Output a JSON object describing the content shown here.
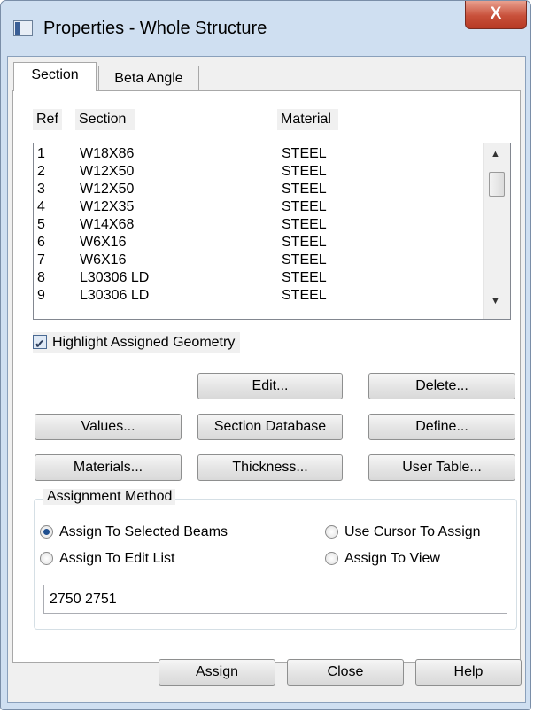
{
  "window": {
    "title": "Properties - Whole Structure",
    "close_label": "X"
  },
  "tabs": [
    {
      "label": "Section",
      "active": true
    },
    {
      "label": "Beta Angle",
      "active": false
    }
  ],
  "list": {
    "headers": {
      "ref": "Ref",
      "section": "Section",
      "material": "Material"
    },
    "rows": [
      {
        "ref": "1",
        "section": "W18X86",
        "material": "STEEL"
      },
      {
        "ref": "2",
        "section": "W12X50",
        "material": "STEEL"
      },
      {
        "ref": "3",
        "section": "W12X50",
        "material": "STEEL"
      },
      {
        "ref": "4",
        "section": "W12X35",
        "material": "STEEL"
      },
      {
        "ref": "5",
        "section": "W14X68",
        "material": "STEEL"
      },
      {
        "ref": "6",
        "section": "W6X16",
        "material": "STEEL"
      },
      {
        "ref": "7",
        "section": "W6X16",
        "material": "STEEL"
      },
      {
        "ref": "8",
        "section": "L30306 LD",
        "material": "STEEL"
      },
      {
        "ref": "9",
        "section": "L30306 LD",
        "material": "STEEL"
      }
    ]
  },
  "highlight": {
    "label": "Highlight Assigned Geometry",
    "checked": true
  },
  "buttons": {
    "edit": "Edit...",
    "delete": "Delete...",
    "values": "Values...",
    "section_database": "Section Database",
    "define": "Define...",
    "materials": "Materials...",
    "thickness": "Thickness...",
    "user_table": "User Table..."
  },
  "assignment": {
    "label": "Assignment Method",
    "selected_beams": "Assign To Selected Beams",
    "cursor": "Use Cursor To Assign",
    "edit_list": "Assign To Edit List",
    "view": "Assign To View",
    "selected": "Assign To Selected Beams",
    "beams_value": "2750 2751"
  },
  "footer": {
    "assign": "Assign",
    "close": "Close",
    "help": "Help"
  }
}
